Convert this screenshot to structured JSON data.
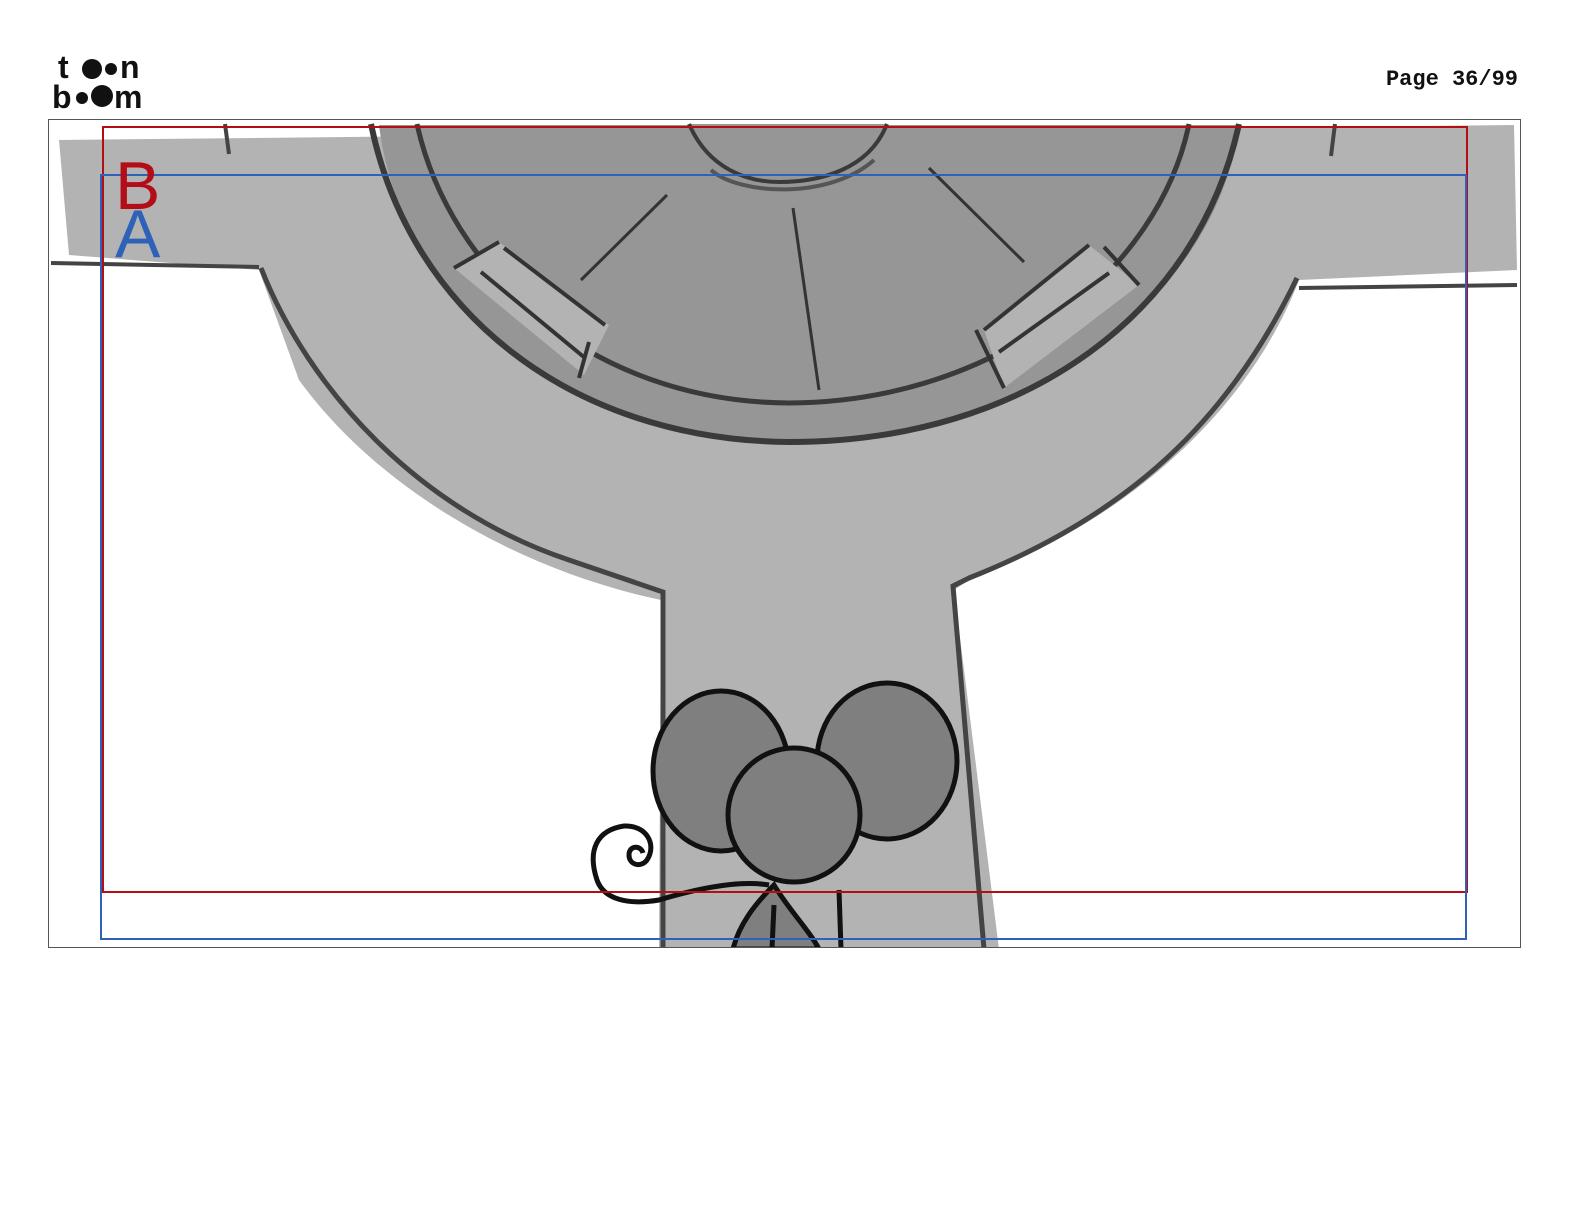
{
  "header": {
    "logo_text": "toon boom",
    "page_label": "Page 36/99"
  },
  "panel": {
    "layers": [
      {
        "label": "B",
        "color": "#b30d18"
      },
      {
        "label": "A",
        "color": "#2e62b8"
      }
    ],
    "colors": {
      "drawing_fill": "#b3b3b3",
      "wheel_inner": "#969696",
      "mouse_fill": "#7f7f7f",
      "stroke": "#3a3a3a"
    }
  }
}
